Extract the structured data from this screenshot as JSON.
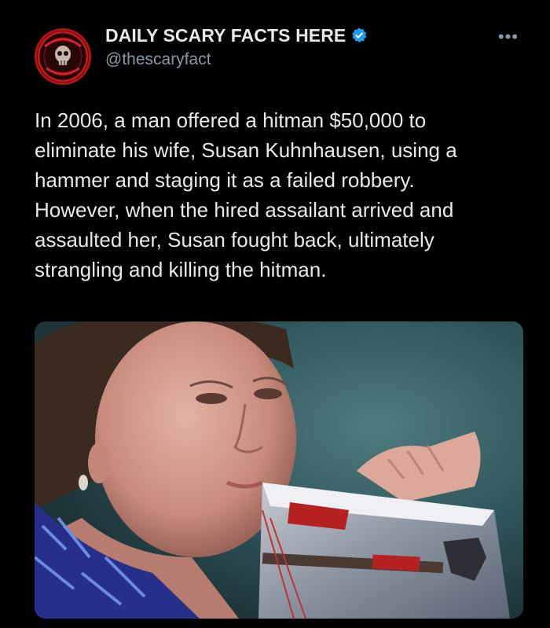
{
  "post": {
    "author": {
      "display_name": "DAILY SCARY FACTS HERE",
      "handle": "@thescaryfact",
      "verified": true,
      "avatar_icon": "skull-emblem-icon"
    },
    "more_label": "•••",
    "text": "In 2006, a man offered a hitman $50,000 to\neliminate his wife, Susan Kuhnhausen, using a\nhammer and staging it as a failed robbery.\nHowever, when the hired assailant arrived and\nassaulted her, Susan fought back, ultimately\nstrangling and killing the hitman.",
    "media": {
      "kind": "photo",
      "icon": "photo-woman-holding-evidence-bag"
    }
  },
  "colors": {
    "background": "#000000",
    "text_primary": "#e7e9ea",
    "text_secondary": "#8b98a5",
    "verified_badge": "#1d9bf0",
    "avatar_ring": "#b01414"
  }
}
